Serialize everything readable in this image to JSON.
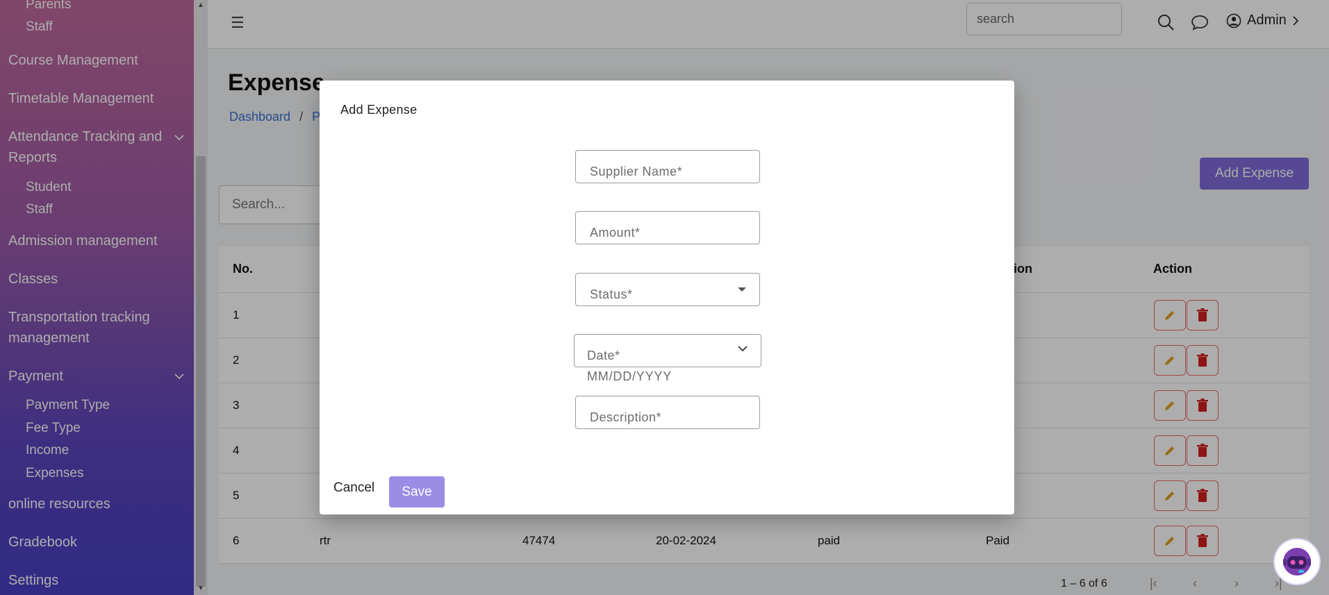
{
  "sidebar": {
    "subitems_top": [
      "Parents",
      "Staff"
    ],
    "items": [
      {
        "label": "Course Management"
      },
      {
        "label": "Timetable Management"
      },
      {
        "label": "Attendance Tracking and Reports"
      },
      {
        "label": "Admission management"
      },
      {
        "label": "Classes"
      },
      {
        "label": "Transportation tracking management"
      },
      {
        "label": "Payment"
      },
      {
        "label": "online resources"
      },
      {
        "label": "Gradebook"
      },
      {
        "label": "Settings"
      }
    ],
    "attendance_sub": [
      "Student",
      "Staff"
    ],
    "payment_sub": [
      "Payment Type",
      "Fee Type",
      "Income",
      "Expenses"
    ]
  },
  "topbar": {
    "search_placeholder": "search",
    "user_label": "Admin"
  },
  "page": {
    "title": "Expense",
    "breadcrumb_home": "Dashboard",
    "breadcrumb_sep": "/",
    "breadcrumb_current": "Pa",
    "add_button": "Add Expense",
    "search_placeholder": "Search..."
  },
  "table": {
    "headers": {
      "no": "No.",
      "description": "ription",
      "action": "Action"
    },
    "rows": [
      {
        "no": "1"
      },
      {
        "no": "2"
      },
      {
        "no": "3"
      },
      {
        "no": "4"
      },
      {
        "no": "5"
      },
      {
        "no": "6",
        "name": "rtr",
        "amount": "47474",
        "date": "20-02-2024",
        "status": "paid",
        "description": "Paid"
      }
    ],
    "pagination": "1 – 6 of 6"
  },
  "modal": {
    "title": "Add Expense",
    "supplier_label": "Supplier Name",
    "amount_label": "Amount",
    "status_label": "Status",
    "date_label": "Date",
    "date_hint": "MM/DD/YYYY",
    "description_label": "Description",
    "required_mark": "*",
    "cancel": "Cancel",
    "save": "Save"
  },
  "colors": {
    "accent": "#7f6ad9",
    "save_button": "#9b8ce6",
    "link": "#3b6fd1",
    "edit_icon": "#e0a020",
    "delete_icon": "#d32020"
  }
}
